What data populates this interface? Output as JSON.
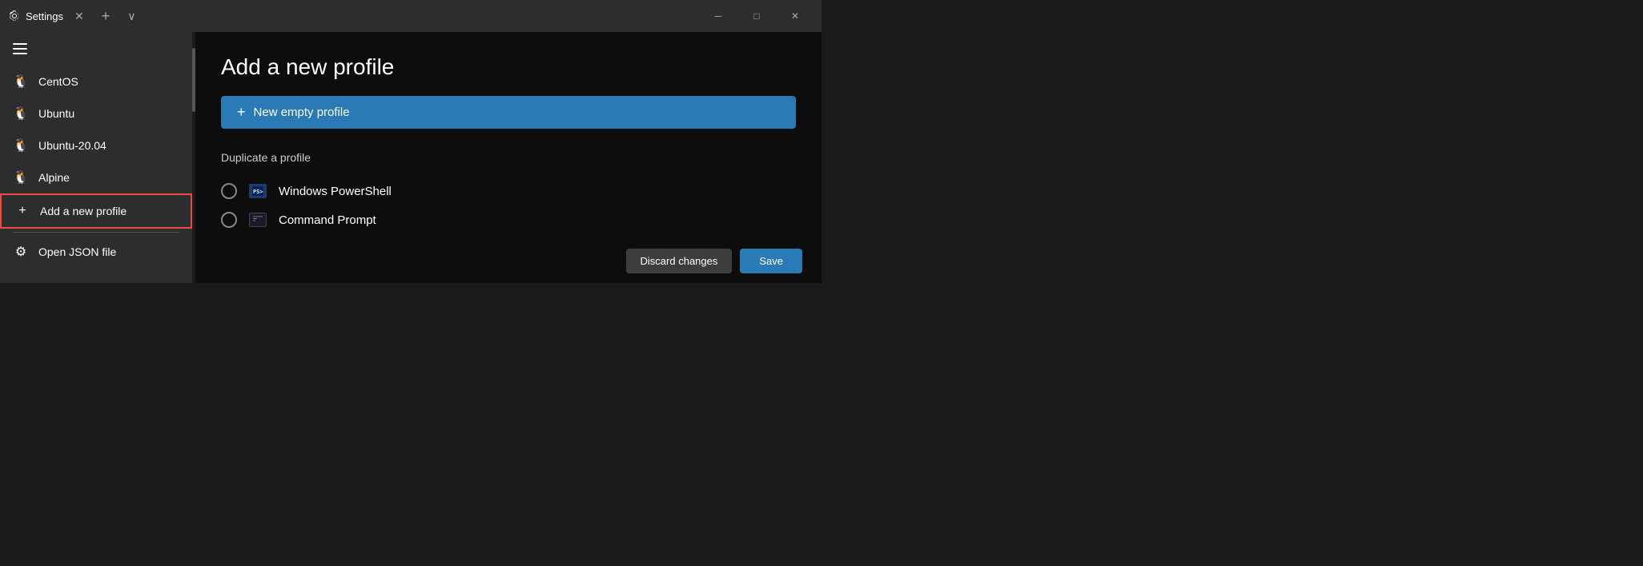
{
  "titlebar": {
    "title": "Settings",
    "close_tab_label": "✕",
    "add_tab_label": "+",
    "dropdown_label": "∨",
    "minimize_label": "─",
    "maximize_label": "□",
    "close_label": "✕"
  },
  "sidebar": {
    "items": [
      {
        "id": "centos",
        "label": "CentOS",
        "icon": "🐧"
      },
      {
        "id": "ubuntu",
        "label": "Ubuntu",
        "icon": "🐧"
      },
      {
        "id": "ubuntu-2004",
        "label": "Ubuntu-20.04",
        "icon": "🐧"
      },
      {
        "id": "alpine",
        "label": "Alpine",
        "icon": "🐧"
      },
      {
        "id": "add-new-profile",
        "label": "Add a new profile",
        "icon": "+",
        "active": true
      }
    ],
    "bottom": {
      "label": "Open JSON file",
      "icon": "⚙"
    }
  },
  "content": {
    "title": "Add a new profile",
    "new_profile_button": "New empty profile",
    "new_profile_plus": "+",
    "duplicate_label": "Duplicate a profile",
    "profiles": [
      {
        "id": "powershell",
        "name": "Windows PowerShell",
        "icon_type": "ps"
      },
      {
        "id": "cmd",
        "name": "Command Prompt",
        "icon_type": "cmd"
      }
    ]
  },
  "actions": {
    "discard_label": "Discard changes",
    "save_label": "Save"
  }
}
